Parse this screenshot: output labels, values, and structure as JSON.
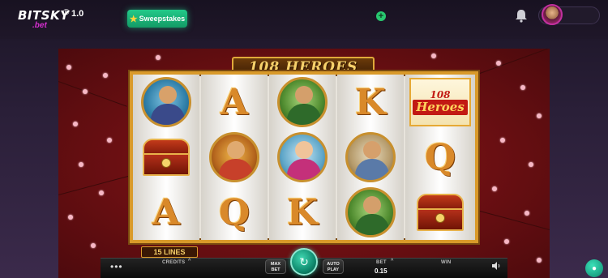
{
  "header": {
    "logo_main": "BITSKY",
    "logo_sub": ".bet",
    "logo_reg": "®",
    "logo_version": "1.0",
    "sweepstakes_label": "Sweepstakes",
    "plus_icon": "+"
  },
  "game": {
    "title": "108 HEROES",
    "lines_label": "15 LINES",
    "logo_tile_line1": "108",
    "logo_tile_line2": "Heroes",
    "reels": [
      [
        "medallion-bald-warrior",
        "chest",
        "A"
      ],
      [
        "A",
        "medallion-armored-warrior",
        "Q"
      ],
      [
        "medallion-green-warrior",
        "medallion-woman-warrior",
        "K"
      ],
      [
        "K",
        "medallion-scholar",
        "medallion-green-warrior"
      ],
      [
        "logo",
        "Q",
        "chest"
      ]
    ]
  },
  "controls": {
    "menu_icon": "•••",
    "credits_label": "CREDITS",
    "max_bet_label_1": "MAX",
    "max_bet_label_2": "BET",
    "auto_play_label_1": "AUTO",
    "auto_play_label_2": "PLAY",
    "bet_label": "BET",
    "bet_value": "0.15",
    "win_label": "WIN",
    "caret_icon": "^"
  },
  "colors": {
    "accent_green": "#22c989",
    "game_red": "#6a0f12",
    "gold": "#d99a2a"
  }
}
